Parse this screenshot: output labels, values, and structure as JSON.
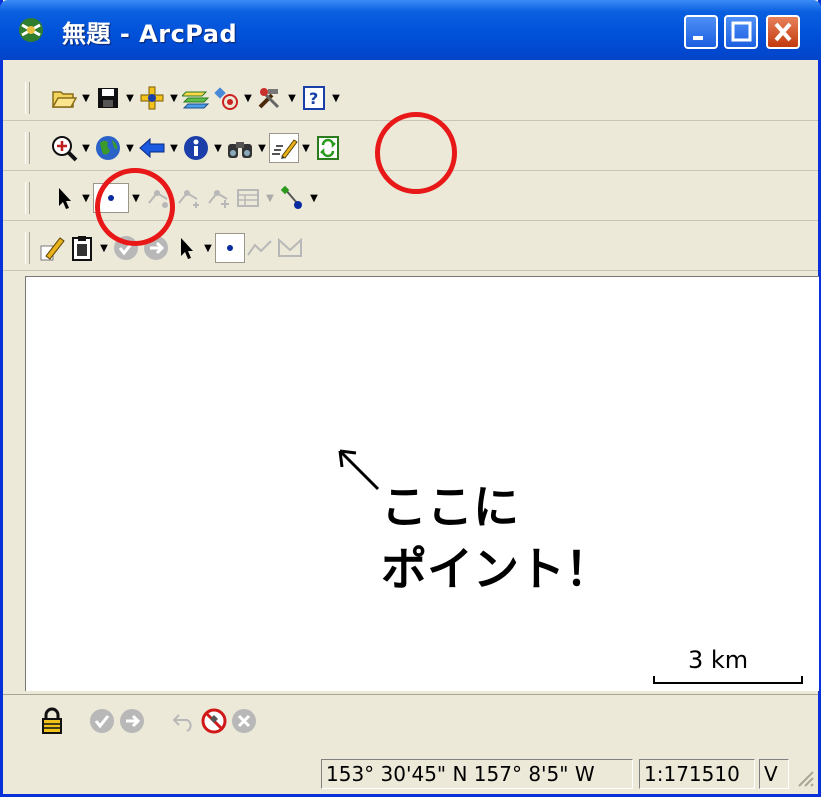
{
  "window": {
    "title": "無題 - ArcPad"
  },
  "toolbars": {
    "file": [
      "open-icon",
      "save-icon",
      "add-layer-icon",
      "layers-icon",
      "gps-icon",
      "tools-icon",
      "help-icon"
    ],
    "navigation": [
      "zoom-in-icon",
      "globe-icon",
      "back-arrow-icon",
      "info-icon",
      "find-icon",
      "edit-pencil-icon",
      "refresh-icon"
    ],
    "edit": [
      "select-arrow-icon",
      "point-icon",
      "vertex-icon",
      "vertex-add-icon",
      "vertex-move-icon",
      "table-icon",
      "gps-vertex-icon"
    ],
    "capture": [
      "edit-tool-icon",
      "clipboard-icon",
      "ok-icon",
      "next-icon",
      "select-icon",
      "point-icon",
      "polyline-icon",
      "polygon-icon"
    ]
  },
  "map": {
    "annotation_line1": "ここに",
    "annotation_line2": "ポイント！",
    "scale_label": "3 km"
  },
  "bottom_toolbar": [
    "lock-icon",
    "ok-icon",
    "next-icon",
    "undo-icon",
    "gps-off-icon",
    "cancel-icon"
  ],
  "status": {
    "coordinates": "153° 30'45\" N 157° 8'5\" W",
    "scale": "1:171510",
    "mode": "V"
  },
  "colors": {
    "title_bar": "#0050d8",
    "highlight": "#e81818",
    "toolbar_bg": "#ece9d8"
  }
}
